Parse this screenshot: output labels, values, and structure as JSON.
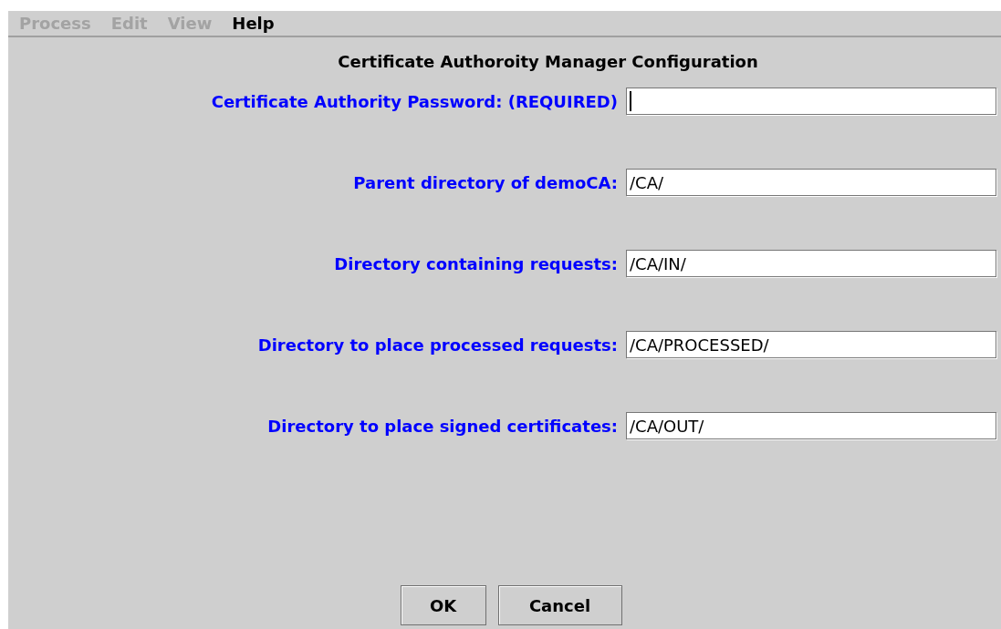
{
  "menu": [
    {
      "label": "Process",
      "disabled": true
    },
    {
      "label": "Edit",
      "disabled": true
    },
    {
      "label": "View",
      "disabled": true
    },
    {
      "label": "Help",
      "disabled": false
    }
  ],
  "title": "Certificate Authoroity Manager Configuration",
  "fields": [
    {
      "label": "Certificate Authority Password: (REQUIRED)",
      "focused": true
    },
    {
      "label": "Parent directory of demoCA:",
      "value": "/CA/",
      "focused": false
    },
    {
      "label": "Directory containing requests:",
      "value": "/CA/IN/",
      "focused": false
    },
    {
      "label": "Directory to place processed requests:",
      "value": "/CA/PROCESSED/",
      "focused": false
    },
    {
      "label": "Directory to place signed certificates:",
      "value": "/CA/OUT/",
      "focused": false
    }
  ],
  "buttons": [
    "OK",
    "Cancel"
  ]
}
